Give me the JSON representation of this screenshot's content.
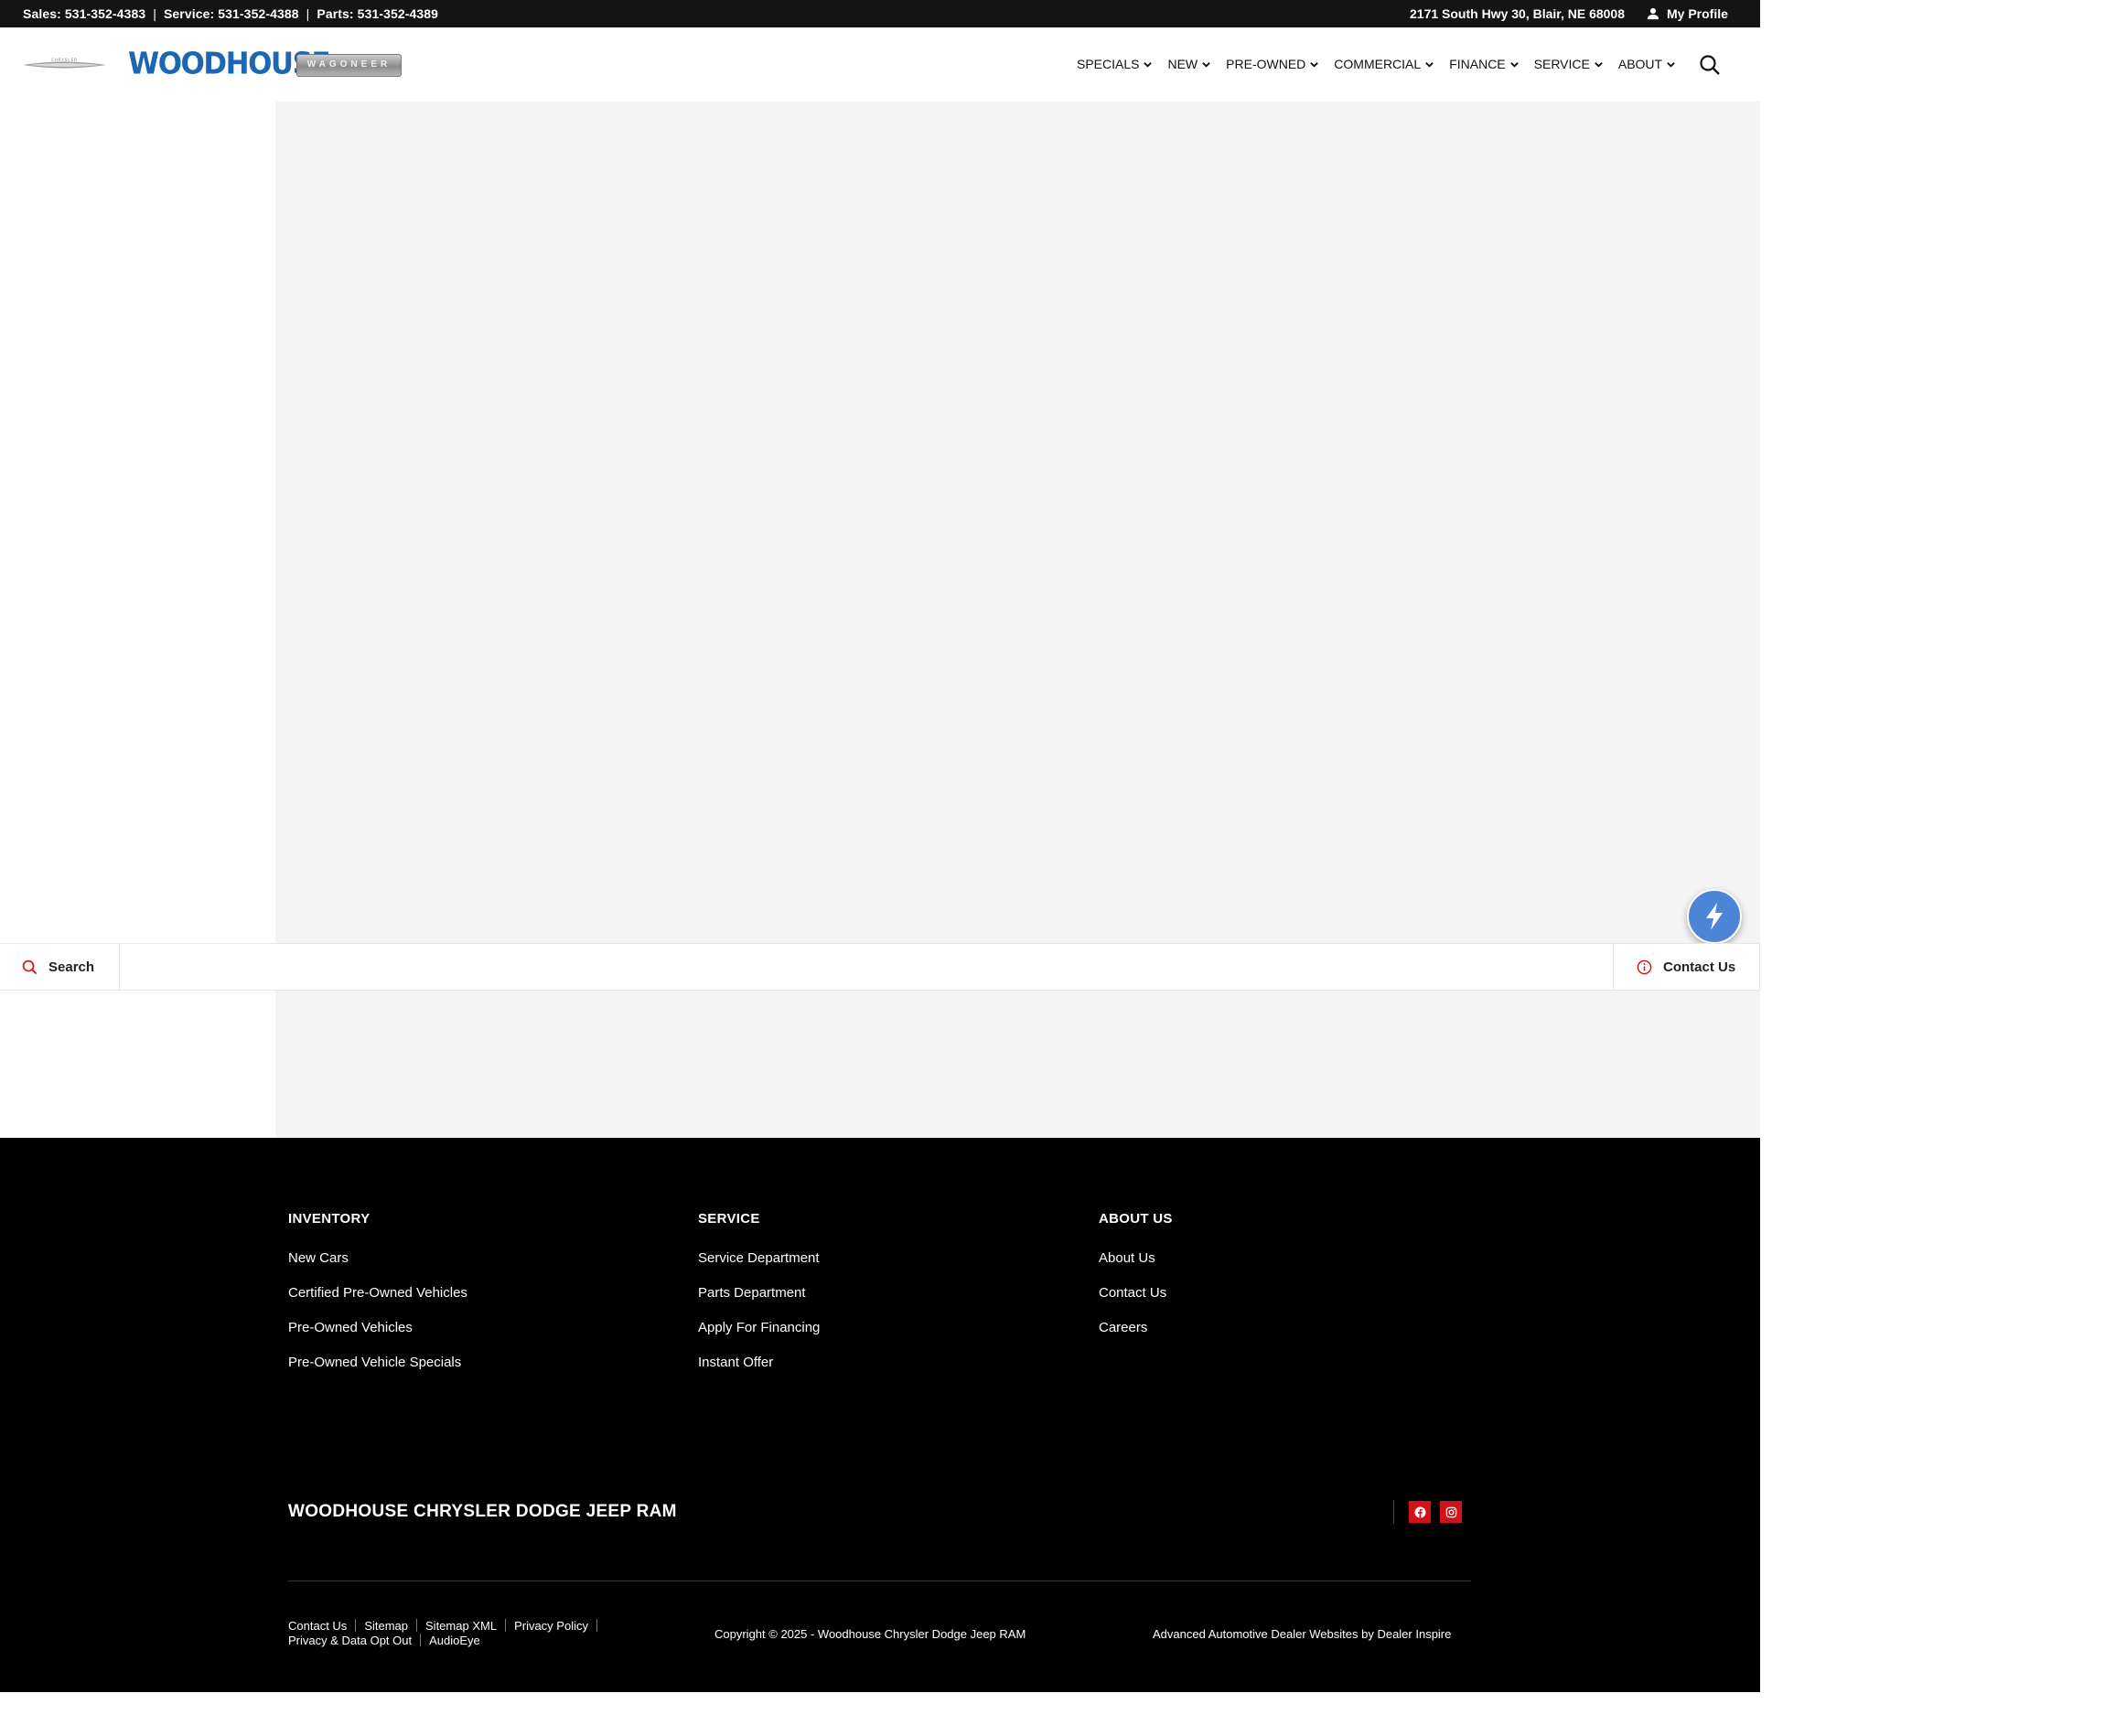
{
  "topbar": {
    "sales": "Sales: 531-352-4383",
    "service": "Service: 531-352-4388",
    "parts": "Parts: 531-352-4389",
    "separator": "|",
    "address": "2171 South Hwy 30, Blair, NE 68008",
    "profile_label": "My Profile"
  },
  "header": {
    "logo_chrysler": "CHRYSLER",
    "logo_woodhouse": "WOODHOUSE",
    "logo_wagoneer": "WAGONEER",
    "nav": [
      {
        "label": "SPECIALS"
      },
      {
        "label": "NEW"
      },
      {
        "label": "PRE-OWNED"
      },
      {
        "label": "COMMERCIAL"
      },
      {
        "label": "FINANCE"
      },
      {
        "label": "SERVICE"
      },
      {
        "label": "ABOUT"
      }
    ]
  },
  "actionbar": {
    "search_label": "Search",
    "contact_label": "Contact Us"
  },
  "footer": {
    "columns": [
      {
        "heading": "INVENTORY",
        "links": [
          "New Cars",
          "Certified Pre-Owned Vehicles",
          "Pre-Owned Vehicles",
          "Pre-Owned Vehicle Specials"
        ]
      },
      {
        "heading": "SERVICE",
        "links": [
          "Service Department",
          "Parts Department",
          "Apply For Financing",
          "Instant Offer"
        ]
      },
      {
        "heading": "ABOUT US",
        "links": [
          "About Us",
          "Contact Us",
          "Careers"
        ]
      }
    ],
    "dealer_name": "WOODHOUSE CHRYSLER DODGE JEEP RAM",
    "bottom_links": [
      "Contact Us",
      "Sitemap",
      "Sitemap XML",
      "Privacy Policy",
      "Privacy & Data Opt Out",
      "AudioEye"
    ],
    "copyright": "Copyright © 2025 - Woodhouse Chrysler Dodge Jeep RAM",
    "credit": "Advanced Automotive Dealer Websites by Dealer Inspire"
  },
  "colors": {
    "topbar_bg": "#141414",
    "brand_blue": "#1c67b1",
    "content_gray": "#f4f4f4",
    "accent_red": "#d0121b",
    "bolt_blue": "#4c84d6",
    "footer_bg": "#000000"
  },
  "icons": {
    "profile": "user-icon",
    "nav_chevron": "chevron-down-icon",
    "search": "search-icon",
    "contact": "info-icon",
    "bolt": "lightning-bolt-icon",
    "facebook": "facebook-icon",
    "instagram": "instagram-icon"
  }
}
